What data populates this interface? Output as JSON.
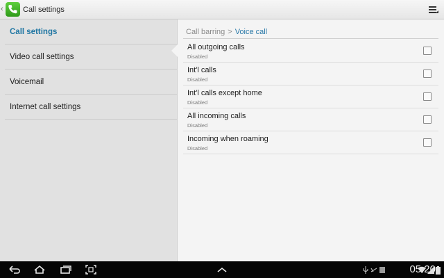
{
  "titlebar": {
    "title": "Call settings"
  },
  "sidebar": {
    "items": [
      {
        "label": "Call settings"
      },
      {
        "label": "Video call settings"
      },
      {
        "label": "Voicemail"
      },
      {
        "label": "Internet call settings"
      }
    ]
  },
  "breadcrumb": {
    "parent": "Call barring",
    "separator": ">",
    "current": "Voice call"
  },
  "barring": {
    "items": [
      {
        "title": "All outgoing calls",
        "status": "Disabled",
        "checked": false
      },
      {
        "title": "Int'l calls",
        "status": "Disabled",
        "checked": false
      },
      {
        "title": "Int'l calls except home",
        "status": "Disabled",
        "checked": false
      },
      {
        "title": "All incoming calls",
        "status": "Disabled",
        "checked": false
      },
      {
        "title": "Incoming when roaming",
        "status": "Disabled",
        "checked": false
      }
    ]
  },
  "statusbar": {
    "time": "05:20"
  },
  "colors": {
    "accent": "#1f76a3",
    "sidebar_bg": "#e1e1e1",
    "content_bg": "#f4f4f4",
    "navbar_bg": "#050505"
  }
}
